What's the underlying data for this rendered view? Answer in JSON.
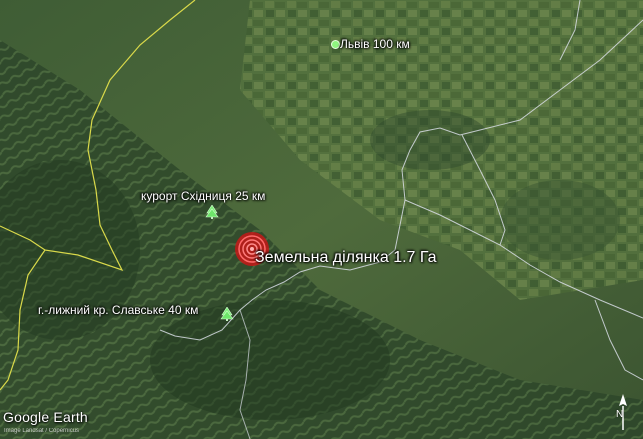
{
  "map": {
    "labels": {
      "lviv": "Львів 100 км",
      "skhidnytsia": "курорт Східниця 25 км",
      "slavske": "г.-лижний кр. Славське 40 км",
      "plot": "Земельна ділянка 1.7 Га"
    },
    "brand": "Google Earth",
    "attribution": "Image Landsat / Copernicus",
    "compass": "N",
    "colors": {
      "terrain_dark": "#2f4a2c",
      "terrain_light": "#5f7a45",
      "border_yellow": "#d9d94a",
      "border_white": "#d8dde6",
      "plot_marker": "#e02020"
    }
  }
}
